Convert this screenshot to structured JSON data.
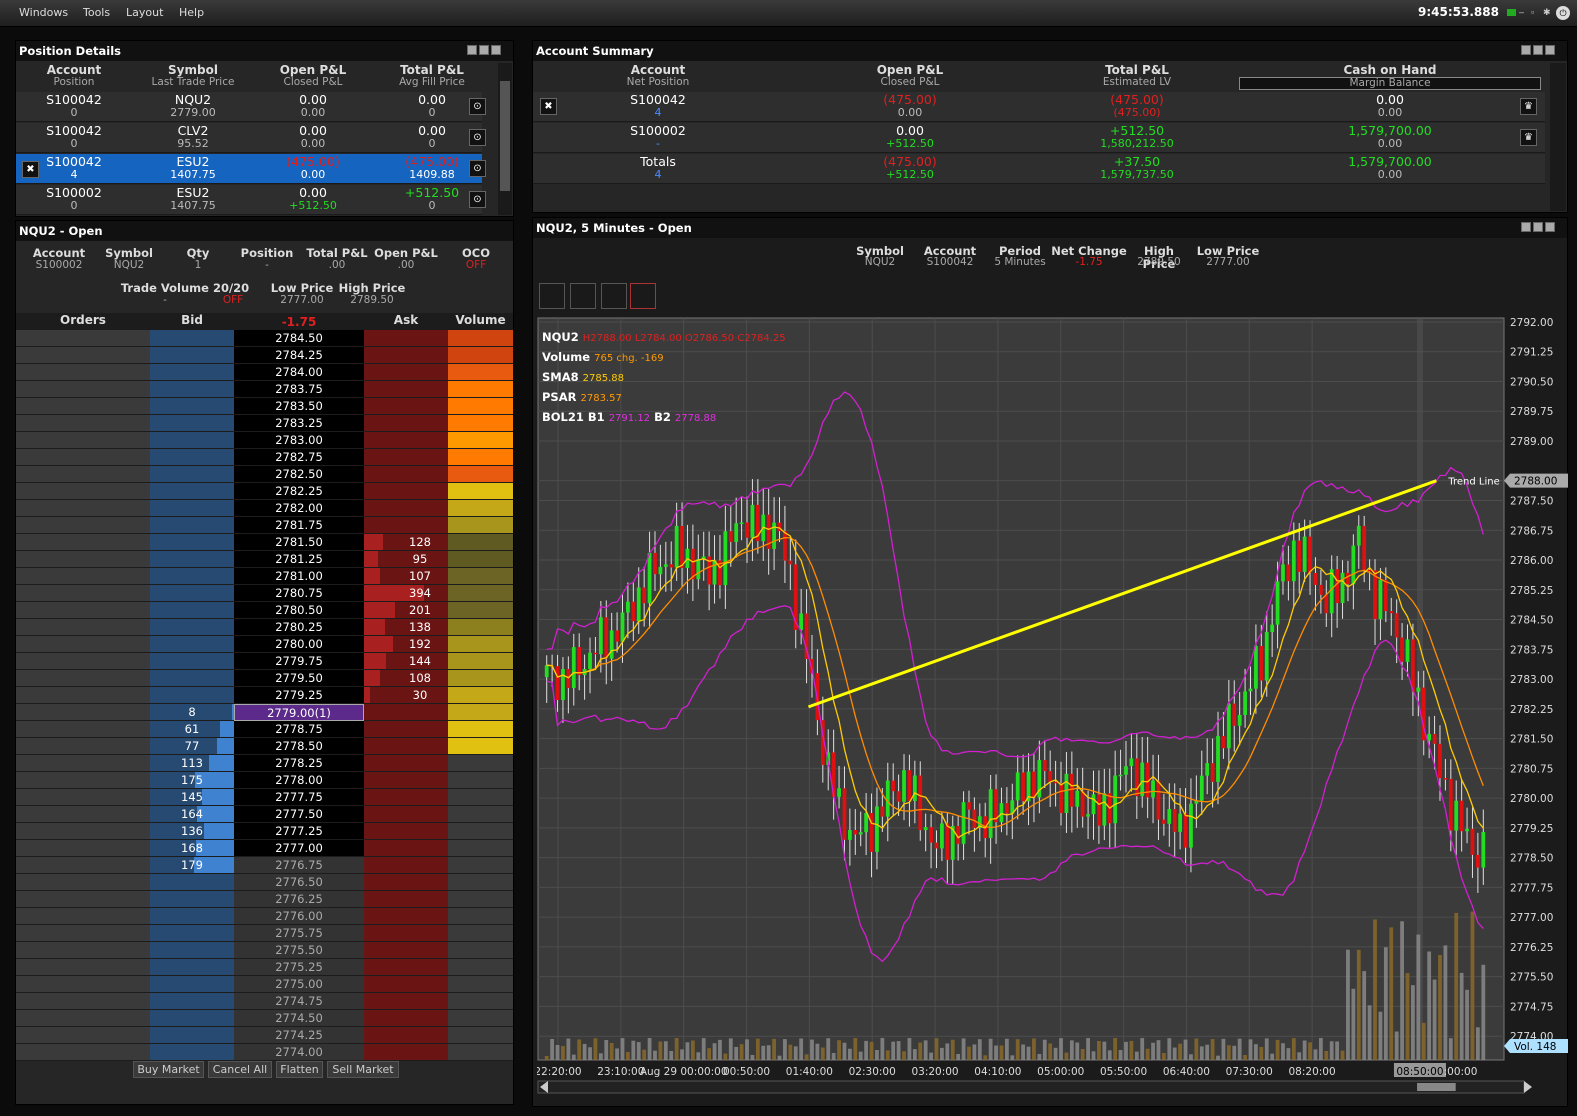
{
  "menu": {
    "items": [
      "Windows",
      "Tools",
      "Layout",
      "Help"
    ],
    "clock": "9:45:53.888"
  },
  "position_details": {
    "title": "Position Details",
    "headers": [
      [
        "Account",
        "Position"
      ],
      [
        "Symbol",
        "Last Trade Price"
      ],
      [
        "Open P&L",
        "Closed P&L"
      ],
      [
        "Total P&L",
        "Avg Fill Price"
      ]
    ],
    "rows": [
      {
        "account": "S100042",
        "position": "0",
        "symbol": "NQU2",
        "last": "2779.00",
        "open": "0.00",
        "closed": "0.00",
        "total": "0.00",
        "avg": "0",
        "selected": false
      },
      {
        "account": "S100042",
        "position": "0",
        "symbol": "CLV2",
        "last": "95.52",
        "open": "0.00",
        "closed": "0.00",
        "total": "0.00",
        "avg": "0",
        "selected": false
      },
      {
        "account": "S100042",
        "position": "4",
        "symbol": "ESU2",
        "last": "1407.75",
        "open": "(475.00)",
        "closed": "0.00",
        "total": "(475.00)",
        "avg": "1409.88",
        "selected": true
      },
      {
        "account": "S100002",
        "position": "0",
        "symbol": "ESU2",
        "last": "1407.75",
        "open": "0.00",
        "closed": "+512.50",
        "total": "+512.50",
        "avg": "0",
        "selected": false
      }
    ]
  },
  "account_summary": {
    "title": "Account Summary",
    "headers": [
      [
        "Account",
        "Net Position"
      ],
      [
        "Open P&L",
        "Closed P&L"
      ],
      [
        "Total P&L",
        "Estimated LV"
      ],
      [
        "Cash on Hand",
        "Margin Balance"
      ]
    ],
    "rows": [
      {
        "account": "S100042",
        "net": "4",
        "open": "(475.00)",
        "closed": "0.00",
        "total": "(475.00)",
        "lv": "(475.00)",
        "cash": "0.00",
        "margin": "0.00"
      },
      {
        "account": "S100002",
        "net": "-",
        "open": "0.00",
        "closed": "+512.50",
        "total": "+512.50",
        "lv": "1,580,212.50",
        "cash": "1,579,700.00",
        "margin": "0.00"
      },
      {
        "account": "Totals",
        "net": "4",
        "open": "(475.00)",
        "closed": "+512.50",
        "total": "+37.50",
        "lv": "1,579,737.50",
        "cash": "1,579,700.00",
        "margin": "0.00"
      }
    ]
  },
  "order_ticket": {
    "title": "NQU2 - Open",
    "fields": [
      {
        "label": "Account",
        "value": "S100002"
      },
      {
        "label": "Symbol",
        "value": "NQU2"
      },
      {
        "label": "Qty",
        "value": "1"
      },
      {
        "label": "Position",
        "value": "-"
      },
      {
        "label": "Total P&L",
        "value": ".00"
      },
      {
        "label": "Open P&L",
        "value": ".00"
      },
      {
        "label": "OCO",
        "value": "OFF"
      }
    ],
    "trade_volume_label": "Trade Volume 20/20",
    "trade_volume_value": "-",
    "trade_volume_off": "OFF",
    "low_label": "Low Price",
    "low_value": "2777.00",
    "high_label": "High Price",
    "high_value": "2789.50",
    "ladder_headers": {
      "orders": "Orders",
      "bid": "Bid",
      "change": "-1.75",
      "ask": "Ask",
      "volume": "Volume"
    },
    "ladder": [
      {
        "p": "2784.50",
        "ask": "",
        "bid": "",
        "vol": 1.0
      },
      {
        "p": "2784.25",
        "ask": "",
        "bid": "",
        "vol": 1.0
      },
      {
        "p": "2784.00",
        "ask": "",
        "bid": "",
        "vol": 0.9
      },
      {
        "p": "2783.75",
        "ask": "",
        "bid": "",
        "vol": 0.85
      },
      {
        "p": "2783.50",
        "ask": "",
        "bid": "",
        "vol": 0.8
      },
      {
        "p": "2783.25",
        "ask": "",
        "bid": "",
        "vol": 0.8
      },
      {
        "p": "2783.00",
        "ask": "",
        "bid": "",
        "vol": 0.75
      },
      {
        "p": "2782.75",
        "ask": "",
        "bid": "",
        "vol": 0.85
      },
      {
        "p": "2782.50",
        "ask": "",
        "bid": "",
        "vol": 0.9
      },
      {
        "p": "2782.25",
        "ask": "",
        "bid": "",
        "vol": 0.6
      },
      {
        "p": "2782.00",
        "ask": "",
        "bid": "",
        "vol": 0.55
      },
      {
        "p": "2781.75",
        "ask": "",
        "bid": "",
        "vol": 0.4
      },
      {
        "p": "2781.50",
        "ask": "128",
        "bid": "",
        "vol": 0.2
      },
      {
        "p": "2781.25",
        "ask": "95",
        "bid": "",
        "vol": 0.2
      },
      {
        "p": "2781.00",
        "ask": "107",
        "bid": "",
        "vol": 0.25
      },
      {
        "p": "2780.75",
        "ask": "394",
        "bid": "",
        "vol": 0.3
      },
      {
        "p": "2780.50",
        "ask": "201",
        "bid": "",
        "vol": 0.3
      },
      {
        "p": "2780.25",
        "ask": "138",
        "bid": "",
        "vol": 0.35
      },
      {
        "p": "2780.00",
        "ask": "192",
        "bid": "",
        "vol": 0.4
      },
      {
        "p": "2779.75",
        "ask": "144",
        "bid": "",
        "vol": 0.45
      },
      {
        "p": "2779.50",
        "ask": "108",
        "bid": "",
        "vol": 0.45
      },
      {
        "p": "2779.25",
        "ask": "30",
        "bid": "",
        "vol": 0.5
      },
      {
        "p": "2779.00(1)",
        "ask": "",
        "bid": "8",
        "vol": 0.55,
        "current": true
      },
      {
        "p": "2778.75",
        "ask": "",
        "bid": "61",
        "vol": 0.6
      },
      {
        "p": "2778.50",
        "ask": "",
        "bid": "77",
        "vol": 0.6
      },
      {
        "p": "2778.25",
        "ask": "",
        "bid": "113",
        "vol": 0
      },
      {
        "p": "2778.00",
        "ask": "",
        "bid": "175",
        "vol": 0
      },
      {
        "p": "2777.75",
        "ask": "",
        "bid": "145",
        "vol": 0
      },
      {
        "p": "2777.50",
        "ask": "",
        "bid": "164",
        "vol": 0
      },
      {
        "p": "2777.25",
        "ask": "",
        "bid": "136",
        "vol": 0
      },
      {
        "p": "2777.00",
        "ask": "",
        "bid": "168",
        "vol": 0
      },
      {
        "p": "2776.75",
        "ask": "",
        "bid": "179",
        "vol": 0
      },
      {
        "p": "2776.50",
        "ask": "",
        "bid": "",
        "vol": 0
      },
      {
        "p": "2776.25",
        "ask": "",
        "bid": "",
        "vol": 0
      },
      {
        "p": "2776.00",
        "ask": "",
        "bid": "",
        "vol": 0
      },
      {
        "p": "2775.75",
        "ask": "",
        "bid": "",
        "vol": 0
      },
      {
        "p": "2775.50",
        "ask": "",
        "bid": "",
        "vol": 0
      },
      {
        "p": "2775.25",
        "ask": "",
        "bid": "",
        "vol": 0
      },
      {
        "p": "2775.00",
        "ask": "",
        "bid": "",
        "vol": 0
      },
      {
        "p": "2774.75",
        "ask": "",
        "bid": "",
        "vol": 0
      },
      {
        "p": "2774.50",
        "ask": "",
        "bid": "",
        "vol": 0
      },
      {
        "p": "2774.25",
        "ask": "",
        "bid": "",
        "vol": 0
      },
      {
        "p": "2774.00",
        "ask": "",
        "bid": "",
        "vol": 0
      }
    ],
    "buttons": [
      "Buy Market",
      "Cancel All",
      "Flatten",
      "Sell Market"
    ]
  },
  "chart_panel": {
    "title": "NQU2, 5 Minutes - Open",
    "info": [
      {
        "label": "Symbol",
        "value": "NQU2"
      },
      {
        "label": "Account",
        "value": "S100042"
      },
      {
        "label": "Period",
        "value": "5 Minutes"
      },
      {
        "label": "Net Change",
        "value": "-1.75"
      },
      {
        "label": "High Price",
        "value": "2789.50"
      },
      {
        "label": "Low Price",
        "value": "2777.00"
      }
    ],
    "legend": {
      "ohlc_label": "NQU2",
      "ohlc": "H2788.00 L2784.00 O2786.50 C2784.25",
      "volume_label": "Volume",
      "volume": "765 chg. -169",
      "sma_label": "SMA8",
      "sma": "2785.88",
      "psar_label": "PSAR",
      "psar": "2783.57",
      "bol_label": "BOL21",
      "b1_label": "B1",
      "b1": "2791.12",
      "b2_label": "B2",
      "b2": "2778.88"
    },
    "trend_line_label": "Trend Line",
    "current_price_tag": "2788.00",
    "volume_tag": "Vol. 148",
    "crosshair_time": "08:50:00",
    "colors": {
      "up": "#22dd22",
      "down": "#e01010",
      "sma": "#ffcc00",
      "psar": "#ff8c00",
      "bollinger": "#d020d0",
      "trend": "#ffff00",
      "volume": "#8a8a8a"
    }
  },
  "chart_data": {
    "type": "candlestick",
    "title": "NQU2, 5 Minutes",
    "ylim": [
      2773.4,
      2792.1
    ],
    "y_ticks": [
      "2792.00",
      "2791.25",
      "2790.50",
      "2789.75",
      "2789.00",
      "2788.00",
      "2787.50",
      "2786.75",
      "2786.00",
      "2785.25",
      "2784.50",
      "2783.75",
      "2783.00",
      "2782.25",
      "2781.50",
      "2780.75",
      "2780.00",
      "2779.25",
      "2778.50",
      "2777.75",
      "2777.00",
      "2776.25",
      "2775.50",
      "2774.75",
      "2774.00"
    ],
    "x_ticks": [
      "22:20:00",
      "23:10:00",
      "Aug 29 00:00:00",
      "00:50:00",
      "01:40:00",
      "02:30:00",
      "03:20:00",
      "04:10:00",
      "05:00:00",
      "05:50:00",
      "06:40:00",
      "07:30:00",
      "08:20:00",
      "08:50:00",
      ":00:00"
    ],
    "close_path": [
      2783.1,
      2783.0,
      2783.3,
      2783.8,
      2784.1,
      2784.6,
      2785.4,
      2785.9,
      2786.2,
      2786.0,
      2785.6,
      2786.2,
      2787.1,
      2786.7,
      2786.9,
      2785.6,
      2783.6,
      2781.3,
      2779.7,
      2779.0,
      2779.3,
      2780.0,
      2780.5,
      2779.6,
      2778.7,
      2779.1,
      2779.6,
      2779.4,
      2779.8,
      2780.1,
      2780.6,
      2780.5,
      2780.0,
      2779.9,
      2779.5,
      2780.3,
      2780.9,
      2780.2,
      2779.6,
      2779.1,
      2780.0,
      2781.0,
      2781.8,
      2782.6,
      2783.5,
      2785.2,
      2786.3,
      2785.8,
      2784.9,
      2785.5,
      2786.5,
      2785.1,
      2784.6,
      2783.4,
      2782.0,
      2780.6,
      2779.5,
      2778.7
    ],
    "trend_line": [
      [
        2782.3,
        0.28
      ],
      [
        2788.0,
        0.93
      ]
    ],
    "series": [
      {
        "name": "NQU2",
        "type": "candlestick"
      },
      {
        "name": "SMA8"
      },
      {
        "name": "PSAR"
      },
      {
        "name": "BOL21"
      }
    ]
  }
}
